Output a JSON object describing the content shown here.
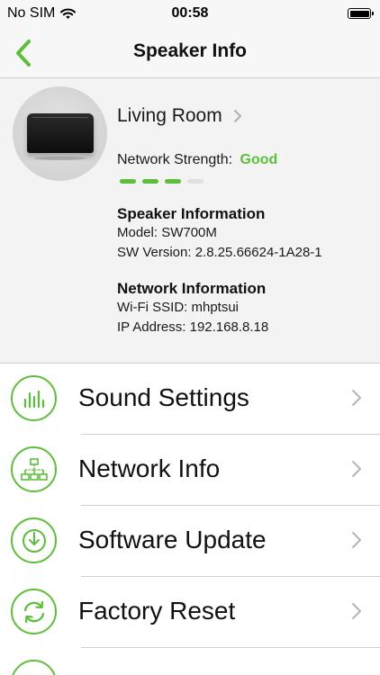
{
  "status_bar": {
    "carrier": "No SIM",
    "time": "00:58"
  },
  "nav": {
    "title": "Speaker Info"
  },
  "speaker": {
    "room": "Living Room",
    "network_strength_label": "Network Strength:",
    "network_strength_value": "Good",
    "signal_level": 3,
    "signal_max": 4,
    "speaker_info_heading": "Speaker Information",
    "model": "Model: SW700M",
    "sw_version": "SW Version: 2.8.25.66624-1A28-1",
    "network_info_heading": "Network Information",
    "wifi_ssid": "Wi-Fi SSID: mhptsui",
    "ip_address": "IP Address: 192.168.8.18"
  },
  "menu": {
    "items": [
      {
        "label": "Sound Settings",
        "icon": "equalizer-icon"
      },
      {
        "label": "Network Info",
        "icon": "network-icon"
      },
      {
        "label": "Software Update",
        "icon": "update-icon"
      },
      {
        "label": "Factory Reset",
        "icon": "reset-icon"
      }
    ]
  },
  "colors": {
    "accent": "#5cbf3a"
  }
}
